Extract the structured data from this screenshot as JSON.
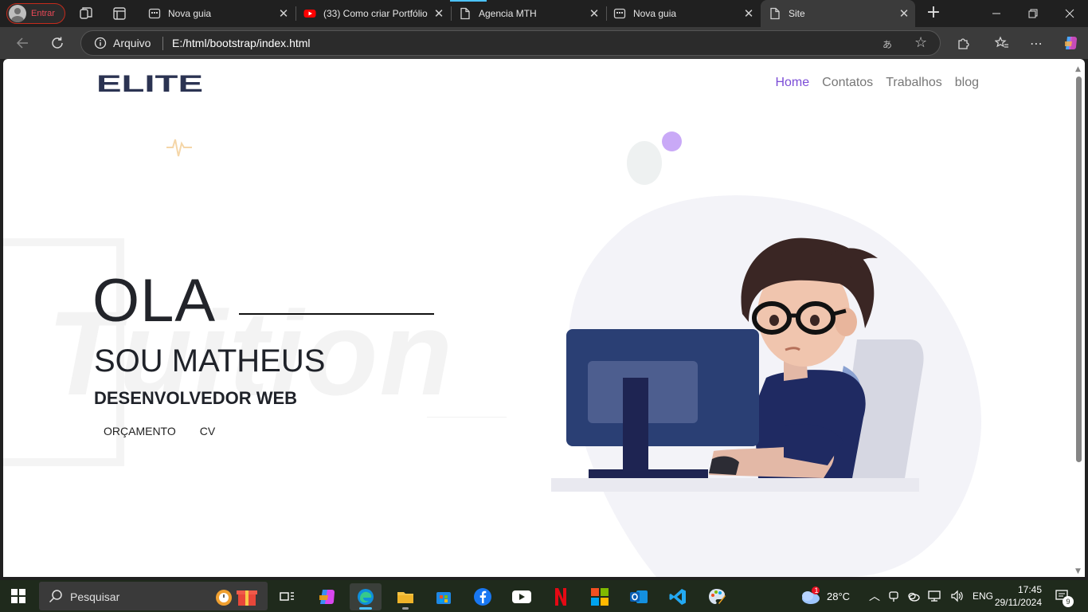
{
  "browser": {
    "profile_label": "Entrar",
    "tabs": [
      {
        "label": "Nova guia",
        "icon": "new-tab-icon"
      },
      {
        "label": "(33) Como criar Portfólio",
        "icon": "youtube-icon"
      },
      {
        "label": "Agencia MTH",
        "icon": "document-icon"
      },
      {
        "label": "Nova guia",
        "icon": "new-tab-icon"
      },
      {
        "label": "Site",
        "icon": "document-icon"
      }
    ],
    "address": {
      "scheme_label": "Arquivo",
      "url": "E:/html/bootstrap/index.html"
    }
  },
  "site": {
    "logo": "ELITE",
    "nav": [
      {
        "label": "Home",
        "active": true
      },
      {
        "label": "Contatos",
        "active": false
      },
      {
        "label": "Trabalhos",
        "active": false
      },
      {
        "label": "blog",
        "active": false
      }
    ],
    "watermark": "Tuition",
    "hero": {
      "greeting": "OLA",
      "name": "SOU MATHEUS",
      "role": "DESENVOLVEDOR WEB",
      "buttons": [
        "ORÇAMENTO",
        "CV"
      ]
    },
    "colors": {
      "accent": "#7c4dd7",
      "text": "#22242a",
      "blob": "#f3f3f8"
    }
  },
  "taskbar": {
    "search_placeholder": "Pesquisar",
    "weather": "28°C",
    "weather_badge": "1",
    "language": "ENG",
    "time": "17:45",
    "date": "29/11/2024",
    "notifications": "9"
  }
}
